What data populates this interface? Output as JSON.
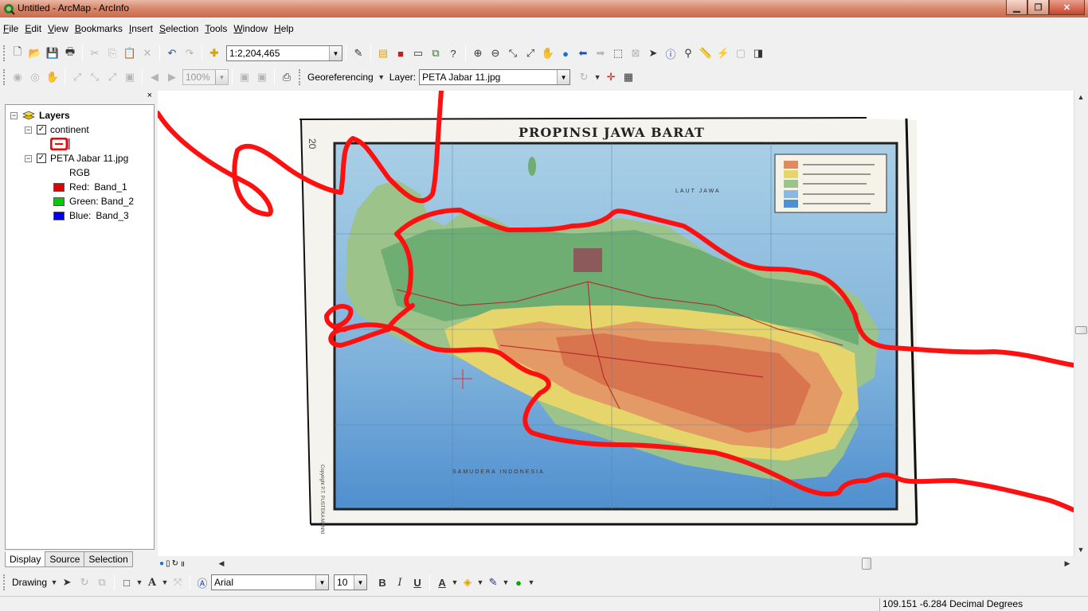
{
  "window": {
    "title": "Untitled - ArcMap - ArcInfo",
    "minimize": "▁",
    "maximize": "❐",
    "close": "✕"
  },
  "menu": [
    "File",
    "Edit",
    "View",
    "Bookmarks",
    "Insert",
    "Selection",
    "Tools",
    "Window",
    "Help"
  ],
  "standard_toolbar": {
    "scale": "1:2,204,465"
  },
  "georef_toolbar": {
    "zoom": "100%",
    "georeferencing_label": "Georeferencing",
    "layer_label": "Layer:",
    "layer_value": "PETA Jabar 11.jpg"
  },
  "toc": {
    "close": "×",
    "root": "Layers",
    "layers": [
      {
        "name": "continent",
        "checked": true
      },
      {
        "name": "PETA Jabar 11.jpg",
        "checked": true,
        "rgb": "RGB",
        "bands": [
          {
            "label": "Red:",
            "band": "Band_1",
            "color": "#e00000"
          },
          {
            "label": "Green:",
            "band": "Band_2",
            "color": "#00cc00"
          },
          {
            "label": "Blue:",
            "band": "Band_3",
            "color": "#0000ee"
          }
        ]
      }
    ],
    "tabs": [
      "Display",
      "Source",
      "Selection"
    ]
  },
  "map": {
    "title": "PROPINSI JAWA BARAT",
    "sea_north": "LAUT JAWA",
    "sea_south": "SAMUDERA INDONESIA",
    "copyright": "Copyright P.T. PUSTEKA MANNI",
    "grid_number": "20",
    "overlay_color": "#ff0000"
  },
  "drawing_toolbar": {
    "drawing_label": "Drawing",
    "font": "Arial",
    "size": "10",
    "bold": "B",
    "italic": "I",
    "underline": "U"
  },
  "status": {
    "coords": "109.151  -6.284 Decimal Degrees"
  }
}
